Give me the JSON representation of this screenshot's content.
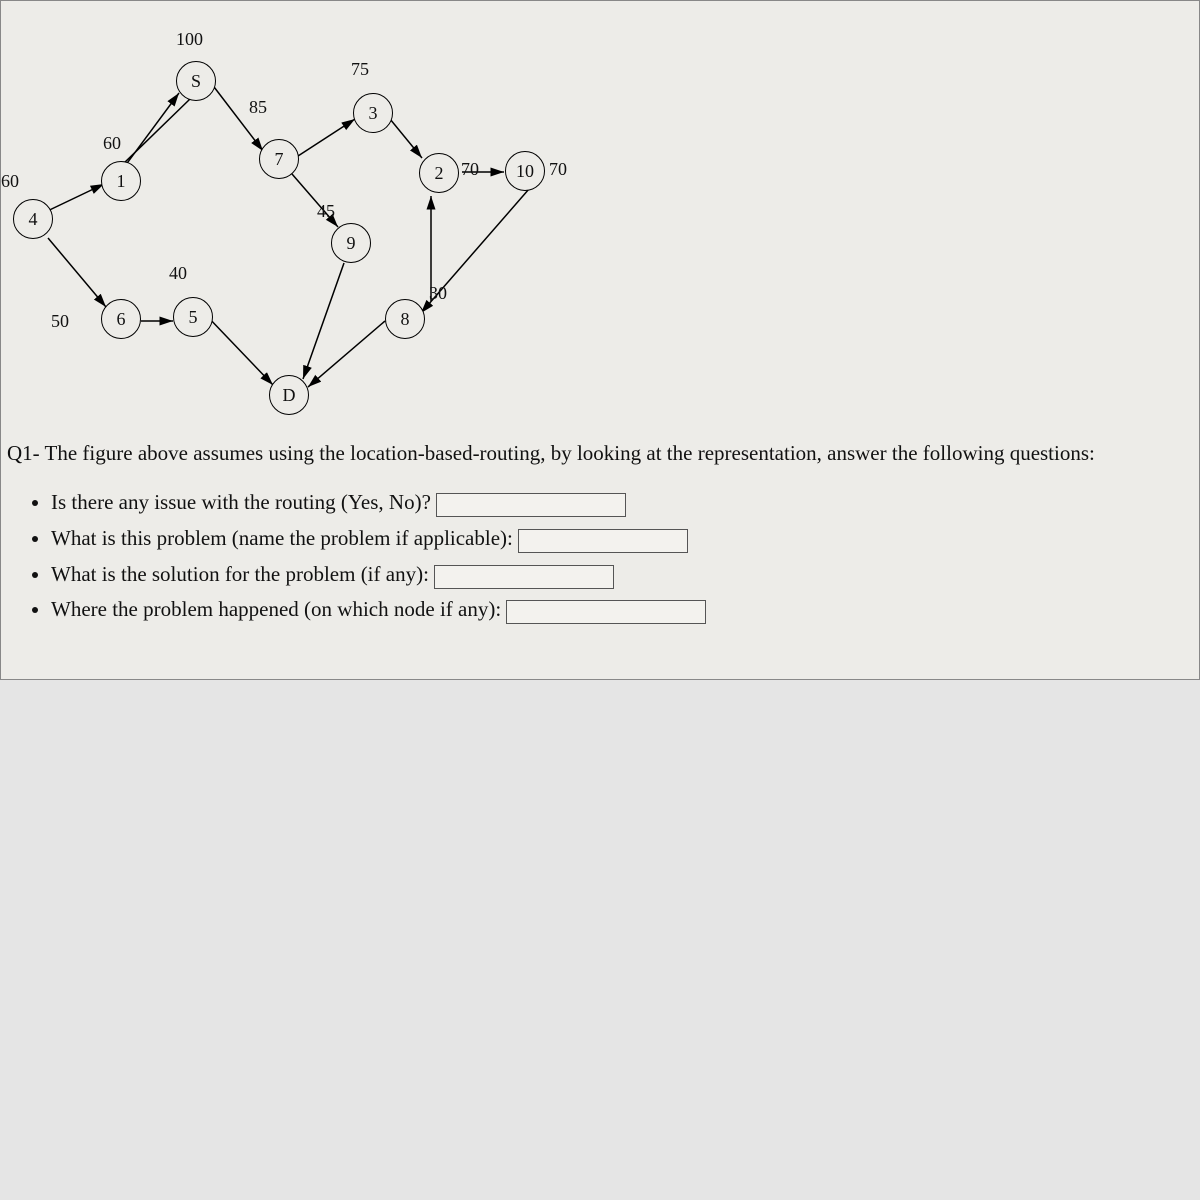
{
  "graph": {
    "nodes": {
      "S": "S",
      "n1": "1",
      "n2": "2",
      "n3": "3",
      "n4": "4",
      "n5": "5",
      "n6": "6",
      "n7": "7",
      "n8": "8",
      "n9": "9",
      "n10": "10",
      "D": "D"
    },
    "edge_labels": {
      "e100": "100",
      "e75": "75",
      "e85": "85",
      "e60a": "60",
      "e60b": "60",
      "e70a": "70",
      "e70b": "70",
      "e45": "45",
      "e40": "40",
      "e50": "50",
      "e30": "30"
    }
  },
  "question": "Q1- The figure above assumes using the location-based-routing, by looking at the representation, answer the following questions:",
  "items": {
    "i1": "Is there any issue with the routing (Yes, No)?",
    "i2": "What is this problem (name the problem if applicable):",
    "i3": "What is the solution for the problem (if any):",
    "i4": "Where the problem happened (on which node if any):"
  }
}
